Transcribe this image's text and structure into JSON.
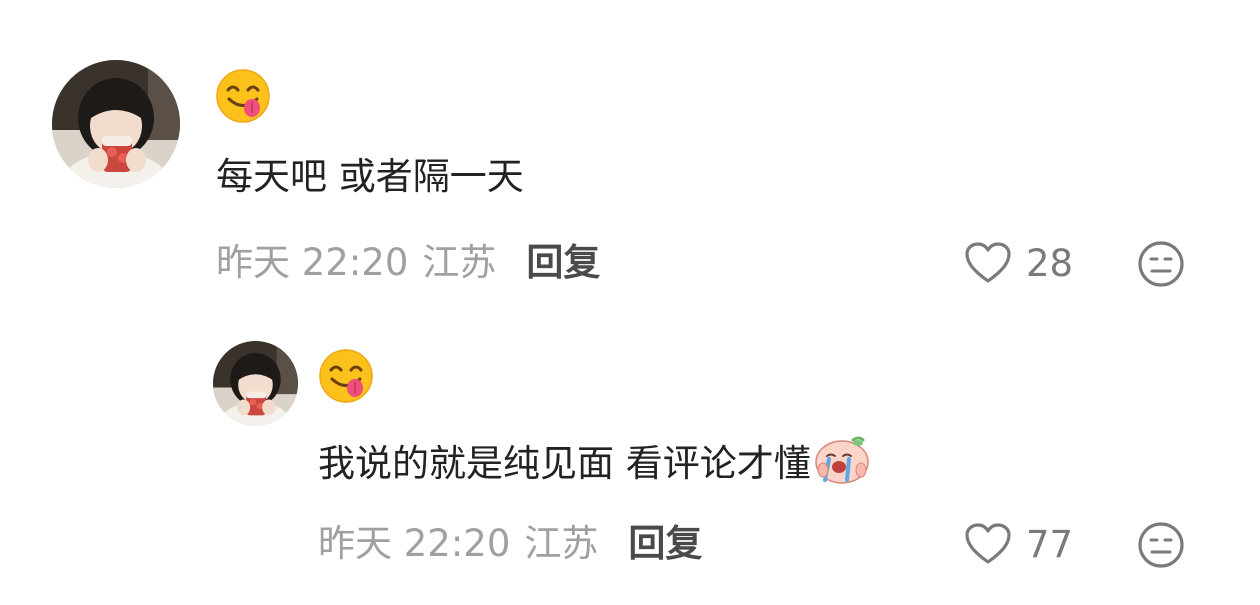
{
  "comments": [
    {
      "nickname_emoji": "yum-face-emoji",
      "text": "每天吧 或者隔一天",
      "time": "昨天 22:20",
      "location": "江苏",
      "reply_label": "回复",
      "likes": "28"
    },
    {
      "nickname_emoji": "yum-face-emoji",
      "text": "我说的就是纯见面 看评论才懂",
      "inline_emoji": "crying-peach-sticker",
      "time": "昨天 22:20",
      "location": "江苏",
      "reply_label": "回复",
      "likes": "77"
    }
  ],
  "icons": {
    "like": "heart-outline-icon",
    "dislike": "meh-face-icon"
  },
  "colors": {
    "text": "#222222",
    "meta": "#a0a0a0",
    "reply": "#4a4a4a",
    "icon": "#7a7a7a"
  }
}
